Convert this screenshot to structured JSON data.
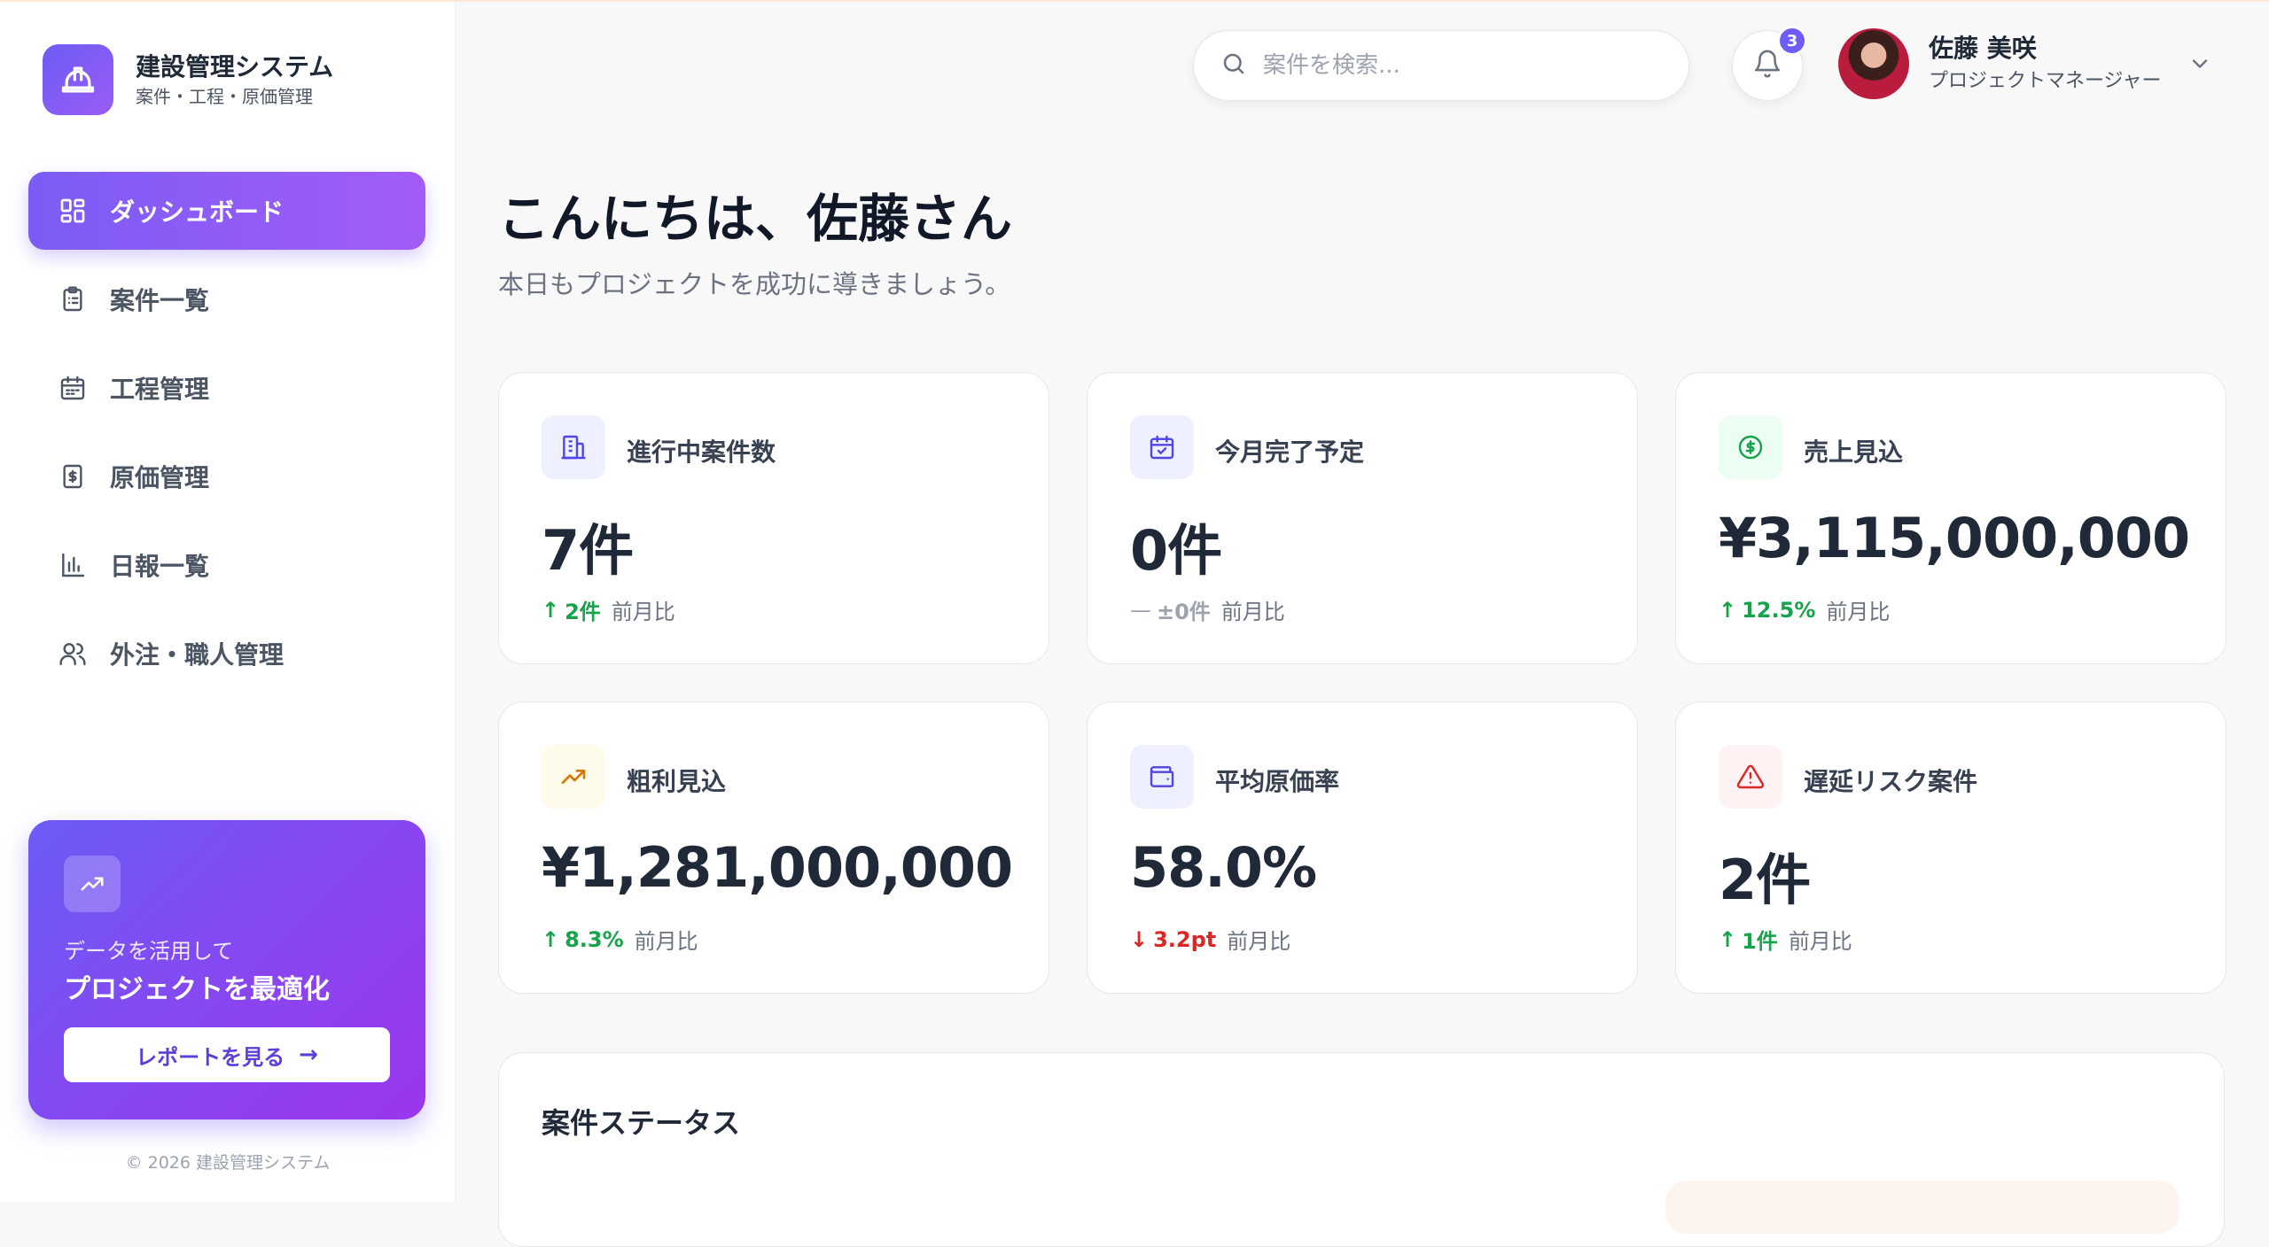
{
  "brand": {
    "title": "建設管理システム",
    "subtitle": "案件・工程・原価管理"
  },
  "nav": {
    "items": [
      {
        "label": "ダッシュボード",
        "icon": "grid-icon",
        "active": true
      },
      {
        "label": "案件一覧",
        "icon": "clipboard-icon",
        "active": false
      },
      {
        "label": "工程管理",
        "icon": "calendar-icon",
        "active": false
      },
      {
        "label": "原価管理",
        "icon": "receipt-icon",
        "active": false
      },
      {
        "label": "日報一覧",
        "icon": "bar-chart-icon",
        "active": false
      },
      {
        "label": "外注・職人管理",
        "icon": "users-icon",
        "active": false
      }
    ]
  },
  "promo": {
    "line1": "データを活用して",
    "line2": "プロジェクトを最適化",
    "button_label": "レポートを見る",
    "button_arrow": "→"
  },
  "footer": {
    "copyright": "© 2026 建設管理システム"
  },
  "header": {
    "search_placeholder": "案件を検索...",
    "notification_count": "3",
    "user_name": "佐藤 美咲",
    "user_role": "プロジェクトマネージャー"
  },
  "greeting": {
    "title": "こんにちは、佐藤さん",
    "subtitle": "本日もプロジェクトを成功に導きましょう。"
  },
  "stats": [
    {
      "title": "進行中案件数",
      "value": "7件",
      "arrow": "↑",
      "delta": "2件",
      "compare": "前月比",
      "trend": "up",
      "icon": "building-icon",
      "icon_bg": "#eef0ff",
      "icon_color": "#4f46e5"
    },
    {
      "title": "今月完了予定",
      "value": "0件",
      "arrow": "—",
      "delta": "±0件",
      "compare": "前月比",
      "trend": "flat",
      "icon": "calendar-check-icon",
      "icon_bg": "#eef0ff",
      "icon_color": "#4f46e5"
    },
    {
      "title": "売上見込",
      "value": "¥3,115,000,000",
      "arrow": "↑",
      "delta": "12.5%",
      "compare": "前月比",
      "trend": "up",
      "icon": "dollar-circle-icon",
      "icon_bg": "#ecfdf3",
      "icon_color": "#16a34a"
    },
    {
      "title": "粗利見込",
      "value": "¥1,281,000,000",
      "arrow": "↑",
      "delta": "8.3%",
      "compare": "前月比",
      "trend": "up",
      "icon": "trending-up-icon",
      "icon_bg": "#fffbeb",
      "icon_color": "#d97706"
    },
    {
      "title": "平均原価率",
      "value": "58.0%",
      "arrow": "↓",
      "delta": "3.2pt",
      "compare": "前月比",
      "trend": "down",
      "icon": "wallet-icon",
      "icon_bg": "#eef0ff",
      "icon_color": "#4f46e5"
    },
    {
      "title": "遅延リスク案件",
      "value": "2件",
      "arrow": "↑",
      "delta": "1件",
      "compare": "前月比",
      "trend": "up",
      "icon": "alert-triangle-icon",
      "icon_bg": "#fef2f2",
      "icon_color": "#dc2626"
    }
  ],
  "status_section": {
    "title": "案件ステータス"
  },
  "colors": {
    "accent": "#7c5cf6",
    "up": "#16a34a",
    "down": "#dc2626",
    "flat": "#9ca3af"
  }
}
